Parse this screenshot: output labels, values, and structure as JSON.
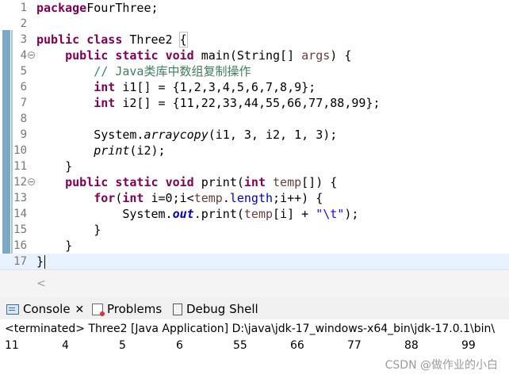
{
  "editor": {
    "line_numbers": [
      "1",
      "2",
      "3",
      "4",
      "5",
      "6",
      "7",
      "8",
      "9",
      "10",
      "11",
      "12",
      "13",
      "14",
      "15",
      "16",
      "17"
    ],
    "lines": [
      {
        "tokens": [
          [
            "kw",
            "package"
          ],
          [
            "",
            "FourThree;"
          ]
        ]
      },
      {
        "tokens": []
      },
      {
        "tokens": [
          [
            "kw",
            "public"
          ],
          [
            "",
            " "
          ],
          [
            "kw",
            "class"
          ],
          [
            "",
            " Three2 "
          ],
          [
            "brace",
            "{"
          ]
        ]
      },
      {
        "tokens": [
          [
            "",
            "    "
          ],
          [
            "kw",
            "public"
          ],
          [
            "",
            " "
          ],
          [
            "kw",
            "static"
          ],
          [
            "",
            " "
          ],
          [
            "kw",
            "void"
          ],
          [
            "",
            " main(String[] "
          ],
          [
            "var",
            "args"
          ],
          [
            "",
            ") {"
          ]
        ]
      },
      {
        "tokens": [
          [
            "",
            "        "
          ],
          [
            "cm",
            "// Java类库中数组复制操作"
          ]
        ]
      },
      {
        "tokens": [
          [
            "",
            "        "
          ],
          [
            "kw",
            "int"
          ],
          [
            "",
            " i1[] = {1,2,3,4,5,6,7,8,9};"
          ]
        ]
      },
      {
        "tokens": [
          [
            "",
            "        "
          ],
          [
            "kw",
            "int"
          ],
          [
            "",
            " i2[] = {11,22,33,44,55,66,77,88,99};"
          ]
        ]
      },
      {
        "tokens": []
      },
      {
        "tokens": [
          [
            "",
            "        System."
          ],
          [
            "it",
            "arraycopy"
          ],
          [
            "",
            "(i1, 3, i2, 1, 3);"
          ]
        ]
      },
      {
        "tokens": [
          [
            "",
            "        "
          ],
          [
            "it",
            "print"
          ],
          [
            "",
            "(i2);"
          ]
        ]
      },
      {
        "tokens": [
          [
            "",
            "    }"
          ]
        ]
      },
      {
        "tokens": [
          [
            "",
            "    "
          ],
          [
            "kw",
            "public"
          ],
          [
            "",
            " "
          ],
          [
            "kw",
            "static"
          ],
          [
            "",
            " "
          ],
          [
            "kw",
            "void"
          ],
          [
            "",
            " print("
          ],
          [
            "kw",
            "int"
          ],
          [
            "",
            " "
          ],
          [
            "var",
            "temp"
          ],
          [
            "",
            "[]) {"
          ]
        ]
      },
      {
        "tokens": [
          [
            "",
            "        "
          ],
          [
            "kw",
            "for"
          ],
          [
            "",
            "("
          ],
          [
            "kw",
            "int"
          ],
          [
            "",
            " i=0;i<"
          ],
          [
            "var",
            "temp"
          ],
          [
            "",
            "."
          ],
          [
            "fld",
            "length"
          ],
          [
            "",
            ";i++) {"
          ]
        ]
      },
      {
        "tokens": [
          [
            "",
            "            System."
          ],
          [
            "sfld",
            "out"
          ],
          [
            "",
            ".print("
          ],
          [
            "var",
            "temp"
          ],
          [
            "",
            "[i] + "
          ],
          [
            "st",
            "\"\\t\""
          ],
          [
            "",
            ");"
          ]
        ]
      },
      {
        "tokens": [
          [
            "",
            "        }"
          ]
        ]
      },
      {
        "tokens": [
          [
            "",
            "    }"
          ]
        ]
      },
      {
        "tokens": [
          [
            "",
            "}"
          ],
          [
            "caret",
            ""
          ]
        ]
      }
    ]
  },
  "scroll": {
    "left_arrow": "<"
  },
  "console_tabs": [
    {
      "icon": "console-icon",
      "label": "Console",
      "close": "✕"
    },
    {
      "icon": "problems-icon",
      "label": "Problems"
    },
    {
      "icon": "debug-shell-icon",
      "label": "Debug Shell"
    }
  ],
  "console": {
    "header": "<terminated> Three2 [Java Application] D:\\java\\jdk-17_windows-x64_bin\\jdk-17.0.1\\bin\\",
    "output": [
      "11",
      "4",
      "5",
      "6",
      "55",
      "66",
      "77",
      "88",
      "99"
    ]
  },
  "watermark": "CSDN @做作业的小白"
}
